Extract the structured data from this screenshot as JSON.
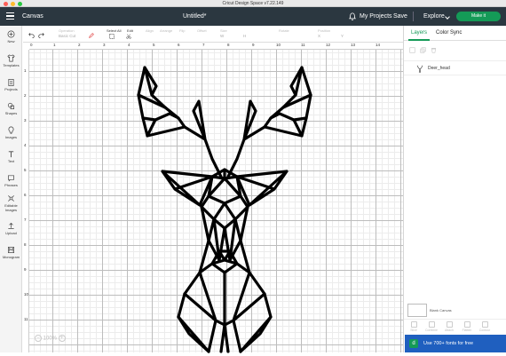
{
  "window": {
    "title": "Cricut Design Space  v7.22.149",
    "traffic_lights": [
      "#fe5f57",
      "#febc2e",
      "#28c840"
    ]
  },
  "header": {
    "app_section": "Canvas",
    "document_title": "Untitled*",
    "my_projects": "My Projects",
    "save": "Save",
    "explore": "Explore",
    "make_it": "Make it",
    "colors": {
      "bar": "#2b3740",
      "accent": "#149a57"
    }
  },
  "sidebar": {
    "items": [
      {
        "label": "New",
        "icon": "plus-circle-icon"
      },
      {
        "label": "Templates",
        "icon": "shirt-icon"
      },
      {
        "label": "Projects",
        "icon": "clipboard-icon"
      },
      {
        "label": "Shapes",
        "icon": "shapes-icon"
      },
      {
        "label": "Images",
        "icon": "lightbulb-icon"
      },
      {
        "label": "Text",
        "icon": "text-icon"
      },
      {
        "label": "Phrases",
        "icon": "speech-bubble-icon"
      },
      {
        "label": "Editable Images",
        "icon": "editable-image-icon"
      },
      {
        "label": "Upload",
        "icon": "upload-icon"
      },
      {
        "label": "Monogram",
        "icon": "monogram-icon"
      }
    ]
  },
  "toolbar": {
    "operation": "Operation",
    "operation_value": "Basic Cut",
    "select_all": "Select All",
    "edit": "Edit",
    "align": "Align",
    "arrange": "Arrange",
    "flip": "Flip",
    "offset": "Offset",
    "size": "Size",
    "rotate": "Rotate",
    "position": "Position",
    "size_w": "W",
    "size_h": "H",
    "pos_x": "X",
    "pos_y": "Y"
  },
  "ruler": {
    "top": [
      "0",
      "1",
      "2",
      "3",
      "4",
      "5",
      "6",
      "7",
      "8",
      "9",
      "10",
      "11",
      "12",
      "13",
      "14"
    ],
    "left": [
      "1",
      "2",
      "3",
      "4",
      "5",
      "6",
      "7",
      "8",
      "9",
      "10",
      "11"
    ]
  },
  "canvas": {
    "zoom": "100%",
    "zoom_out": "−",
    "zoom_in": "+"
  },
  "panel": {
    "tabs": [
      "Layers",
      "Color Sync"
    ],
    "layers": [
      {
        "name": "Deer_head"
      }
    ],
    "blank_canvas": "Blank Canvas",
    "bottom_tools": [
      "Slice",
      "Combine",
      "Attach",
      "Flatten",
      "Contour"
    ],
    "promo": "Use 700+ fonts for free",
    "promo_icon": "d"
  }
}
